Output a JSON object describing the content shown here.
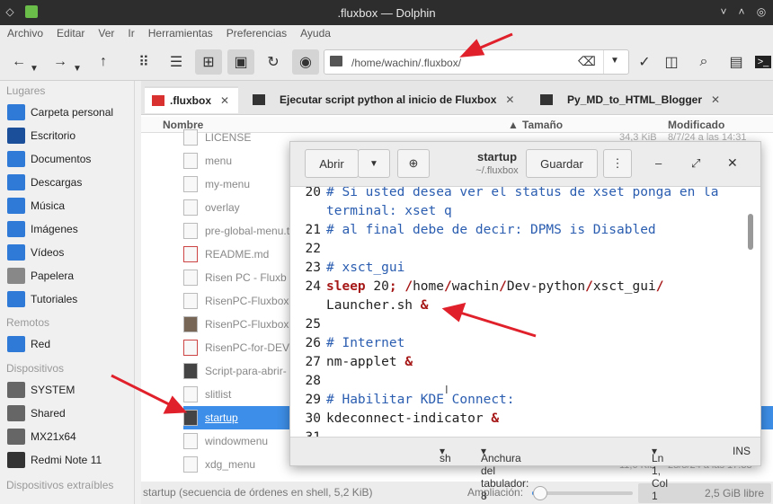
{
  "window": {
    "title": ".fluxbox — Dolphin"
  },
  "menu": [
    "Archivo",
    "Editar",
    "Ver",
    "Ir",
    "Herramientas",
    "Preferencias",
    "Ayuda"
  ],
  "address": {
    "path": "/home/wachin/.fluxbox/"
  },
  "sidebar": {
    "sections": [
      {
        "title": "Lugares",
        "items": [
          "Carpeta personal",
          "Escritorio",
          "Documentos",
          "Descargas",
          "Música",
          "Imágenes",
          "Vídeos",
          "Papelera",
          "Tutoriales"
        ]
      },
      {
        "title": "Remotos",
        "items": [
          "Red"
        ]
      },
      {
        "title": "Dispositivos",
        "items": [
          "SYSTEM",
          "Shared",
          "MX21x64",
          "Redmi Note 11"
        ]
      },
      {
        "title": "Dispositivos extraíbles",
        "items": []
      }
    ]
  },
  "tabs": [
    {
      "label": ".fluxbox"
    },
    {
      "label": "Ejecutar script python al inicio de Fluxbox"
    },
    {
      "label": "Py_MD_to_HTML_Blogger"
    }
  ],
  "columns": {
    "name": "Nombre",
    "size": "Tamaño",
    "modified": "Modificado"
  },
  "files": [
    "LICENSE",
    "menu",
    "my-menu",
    "overlay",
    "pre-global-menu.t",
    "README.md",
    "Risen PC - Fluxb",
    "RisenPC-Fluxbox",
    "RisenPC-Fluxbox",
    "RisenPC-for-DEV",
    "Script-para-abrir-",
    "slitlist",
    "startup",
    "windowmenu",
    "xdg_menu"
  ],
  "selected_file": "startup",
  "partial_cells": {
    "license_size": "34,3 KiB",
    "license_date": "8/7/24 a las 14:31",
    "xdg_size": "11,0 KiB",
    "xdg_date": "28/8/24 a las 17:33"
  },
  "status": {
    "text": "startup (secuencia de órdenes en shell, 5,2 KiB)",
    "zoom_label": "Ampliación:",
    "free": "2,5 GiB libre",
    "zoom_level": 0.03
  },
  "editor": {
    "open_label": "Abrir",
    "save_label": "Guardar",
    "title": "startup",
    "subtitle": "~/.fluxbox",
    "lines": [
      {
        "n": "20",
        "parts": [
          {
            "c": "cm",
            "t": "# Si usted desea ver el status de xset ponga en la"
          }
        ]
      },
      {
        "n": "",
        "parts": [
          {
            "c": "cm",
            "t": "terminal: xset q"
          }
        ]
      },
      {
        "n": "21",
        "parts": [
          {
            "c": "cm",
            "t": "# al final debe de decir: DPMS is Disabled"
          }
        ]
      },
      {
        "n": "22",
        "parts": []
      },
      {
        "n": "23",
        "parts": [
          {
            "c": "cm",
            "t": "# xsct_gui"
          }
        ]
      },
      {
        "n": "24",
        "parts": [
          {
            "c": "kw",
            "t": "sleep"
          },
          {
            "c": "tx",
            "t": " 20"
          },
          {
            "c": "kw",
            "t": ";"
          },
          {
            "c": "tx",
            "t": " "
          },
          {
            "c": "kw",
            "t": "/"
          },
          {
            "c": "tx",
            "t": "home"
          },
          {
            "c": "kw",
            "t": "/"
          },
          {
            "c": "tx",
            "t": "wachin"
          },
          {
            "c": "kw",
            "t": "/"
          },
          {
            "c": "tx",
            "t": "Dev-python"
          },
          {
            "c": "kw",
            "t": "/"
          },
          {
            "c": "tx",
            "t": "xsct_gui"
          },
          {
            "c": "kw",
            "t": "/"
          }
        ]
      },
      {
        "n": "",
        "parts": [
          {
            "c": "tx",
            "t": "Launcher.sh "
          },
          {
            "c": "kw",
            "t": "&"
          }
        ]
      },
      {
        "n": "25",
        "parts": []
      },
      {
        "n": "26",
        "parts": [
          {
            "c": "cm",
            "t": "# Internet"
          }
        ]
      },
      {
        "n": "27",
        "parts": [
          {
            "c": "tx",
            "t": "nm-applet "
          },
          {
            "c": "kw",
            "t": "&"
          }
        ]
      },
      {
        "n": "28",
        "parts": []
      },
      {
        "n": "29",
        "parts": [
          {
            "c": "cm",
            "t": "# Habilitar KDE Connect:"
          }
        ]
      },
      {
        "n": "30",
        "parts": [
          {
            "c": "tx",
            "t": "kdeconnect-indicator "
          },
          {
            "c": "kw",
            "t": "&"
          }
        ]
      },
      {
        "n": "31",
        "parts": []
      }
    ],
    "footer": {
      "lang": "sh",
      "tab_width": "Anchura del tabulador: 8",
      "position": "Ln 1, Col 1",
      "mode": "INS"
    }
  },
  "colors": {
    "accent": "#3d8ee8",
    "folder": "#2f7ad6",
    "comment": "#2a5db0",
    "keyword": "#a61717",
    "arrow": "#e0202a"
  }
}
